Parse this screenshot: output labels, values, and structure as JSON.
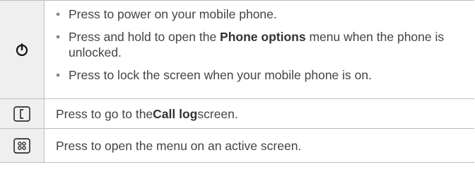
{
  "rows": [
    {
      "icon": "power-icon",
      "items": [
        {
          "pre": "Press to power on your mobile phone.",
          "bold": "",
          "post": ""
        },
        {
          "pre": "Press and hold to open the ",
          "bold": "Phone options",
          "post": " menu when the phone is unlocked."
        },
        {
          "pre": "Press to lock the screen when your mobile phone is on.",
          "bold": "",
          "post": ""
        }
      ]
    },
    {
      "icon": "call-log-key-icon",
      "pre": "Press to go to the ",
      "bold": "Call log",
      "post": " screen."
    },
    {
      "icon": "menu-key-icon",
      "pre": "Press to open the menu on an active screen.",
      "bold": "",
      "post": ""
    }
  ],
  "colors": {
    "text": "#444444",
    "icon_cell_bg": "#efefef",
    "border": "#bdbdbd"
  }
}
